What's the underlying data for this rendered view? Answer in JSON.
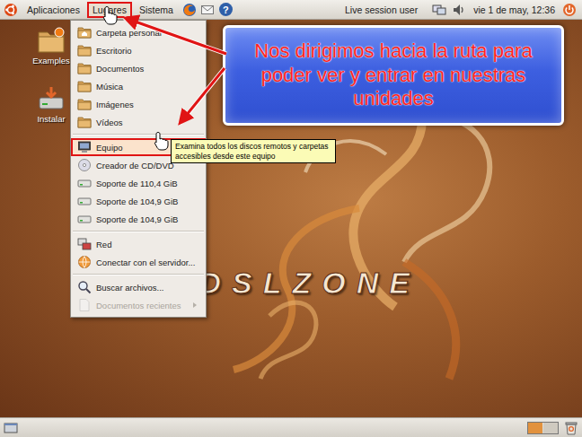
{
  "top_panel": {
    "menus": [
      {
        "label": "Aplicaciones",
        "selected": false
      },
      {
        "label": "Lugares",
        "selected": true
      },
      {
        "label": "Sistema",
        "selected": false
      }
    ],
    "help_glyph": "?",
    "user": "Live session user",
    "clock": "vie 1 de may, 12:36"
  },
  "desktop_icons": [
    {
      "label": "Examples",
      "kind": "examples"
    },
    {
      "label": "Instalar",
      "kind": "install"
    }
  ],
  "places_menu": {
    "groups": [
      [
        {
          "label": "Carpeta personal",
          "kind": "home",
          "selected": false,
          "disabled": false,
          "submenu": false
        },
        {
          "label": "Escritorio",
          "kind": "folder",
          "selected": false,
          "disabled": false,
          "submenu": false
        },
        {
          "label": "Documentos",
          "kind": "folder",
          "selected": false,
          "disabled": false,
          "submenu": false
        },
        {
          "label": "Música",
          "kind": "folder",
          "selected": false,
          "disabled": false,
          "submenu": false
        },
        {
          "label": "Imágenes",
          "kind": "folder",
          "selected": false,
          "disabled": false,
          "submenu": false
        },
        {
          "label": "Vídeos",
          "kind": "folder",
          "selected": false,
          "disabled": false,
          "submenu": false
        }
      ],
      [
        {
          "label": "Equipo",
          "kind": "computer",
          "selected": true,
          "disabled": false,
          "submenu": false
        },
        {
          "label": "Creador de CD/DVD",
          "kind": "disc",
          "selected": false,
          "disabled": false,
          "submenu": false
        },
        {
          "label": "Soporte de 110,4 GiB",
          "kind": "drive",
          "selected": false,
          "disabled": false,
          "submenu": false
        },
        {
          "label": "Soporte de 104,9 GiB",
          "kind": "drive",
          "selected": false,
          "disabled": false,
          "submenu": false
        },
        {
          "label": "Soporte de 104,9 GiB",
          "kind": "drive",
          "selected": false,
          "disabled": false,
          "submenu": false
        }
      ],
      [
        {
          "label": "Red",
          "kind": "network",
          "selected": false,
          "disabled": false,
          "submenu": false
        },
        {
          "label": "Conectar con el servidor...",
          "kind": "connect",
          "selected": false,
          "disabled": false,
          "submenu": false
        }
      ],
      [
        {
          "label": "Buscar archivos...",
          "kind": "search",
          "selected": false,
          "disabled": false,
          "submenu": false
        },
        {
          "label": "Documentos recientes",
          "kind": "recent",
          "selected": false,
          "disabled": true,
          "submenu": true
        }
      ]
    ]
  },
  "tooltip": "Examina todos los discos remotos y carpetas accesibles desde este equipo",
  "callout": "Nos dirigimos hacia la ruta para poder ver y entrar en nuestras unidades",
  "watermark": "ADSLZONE"
}
